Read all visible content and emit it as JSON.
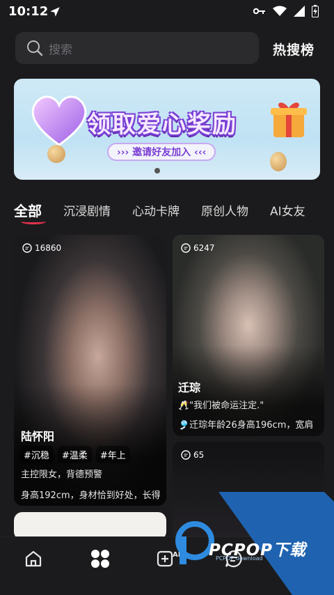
{
  "status_bar": {
    "time": "10:12"
  },
  "search": {
    "placeholder": "搜索"
  },
  "hot_list_label": "热搜榜",
  "banner": {
    "title": "领取爱心奖励",
    "subtitle": "›››  邀请好友加入  ‹‹‹"
  },
  "tabs": [
    {
      "label": "全部",
      "active": true
    },
    {
      "label": "沉浸剧情"
    },
    {
      "label": "心动卡牌"
    },
    {
      "label": "原创人物"
    },
    {
      "label": "AI女友"
    }
  ],
  "cards": [
    {
      "comments": "16860",
      "name": "陆怀阳",
      "tags": [
        "#沉稳",
        "#温柔",
        "#年上"
      ],
      "desc1": "主控限女，背德预警",
      "desc2": "身高192cm，身材恰到好处，长得"
    },
    {
      "comments": "6247",
      "name": "迁琮",
      "quote": "🥂\"我们被命运注定.\"",
      "desc1": "🎐迁琮年龄26身高196cm，宽肩"
    },
    {
      "comments": "65"
    }
  ],
  "bottom_nav": [
    {
      "icon": "home-icon"
    },
    {
      "icon": "grid-icon"
    },
    {
      "icon": "add-ai-icon"
    },
    {
      "icon": "chat-icon"
    }
  ],
  "watermark": {
    "brand": "PCPOP下载",
    "sub": "PCPOP download"
  }
}
